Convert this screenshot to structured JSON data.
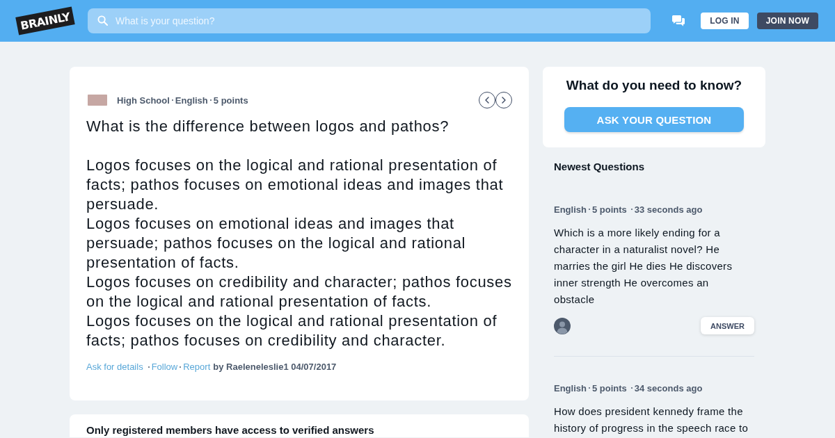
{
  "header": {
    "logo": "BRAINLY",
    "search": {
      "placeholder": "What is your question?"
    },
    "buttons": [
      {
        "label": "LOG IN",
        "kind": "secondary"
      },
      {
        "label": "JOIN NOW",
        "kind": "primary"
      }
    ]
  },
  "question": {
    "level": "High School",
    "subject": "English",
    "points": "5 points",
    "title": "What is the difference between logos and pathos?",
    "options": [
      "Logos focuses on the logical and rational presentation of facts; pathos focuses on emotional ideas and images that persuade.",
      "Logos focuses on emotional ideas and images that persuade; pathos focuses on the logical and rational presentation of facts.",
      "Logos focuses on credibility and character; pathos focuses on the logical and rational presentation of facts.",
      "Logos focuses on the logical and rational presentation of facts; pathos focuses on credibility and character."
    ],
    "actions": [
      "Ask for details",
      "Follow",
      "Report"
    ],
    "byline": "by Raeleneleslie1 04/07/2017"
  },
  "answers_notice": "Only registered members have access to verified answers",
  "ask_box": {
    "title": "What do you need to know?",
    "button": "ASK YOUR QUESTION"
  },
  "newest": {
    "title": "Newest Questions",
    "items": [
      {
        "subject": "English",
        "points": "5 points",
        "time": "33 seconds ago",
        "text": "Which is a more likely ending for a character in a naturalist novel? He marries the girl He dies He discovers inner strength He overcomes an obstacle",
        "button": "ANSWER"
      },
      {
        "subject": "English",
        "points": "5 points",
        "time": "34 seconds ago",
        "text": "How does president kennedy frame the history of progress in the speech race to"
      }
    ]
  }
}
